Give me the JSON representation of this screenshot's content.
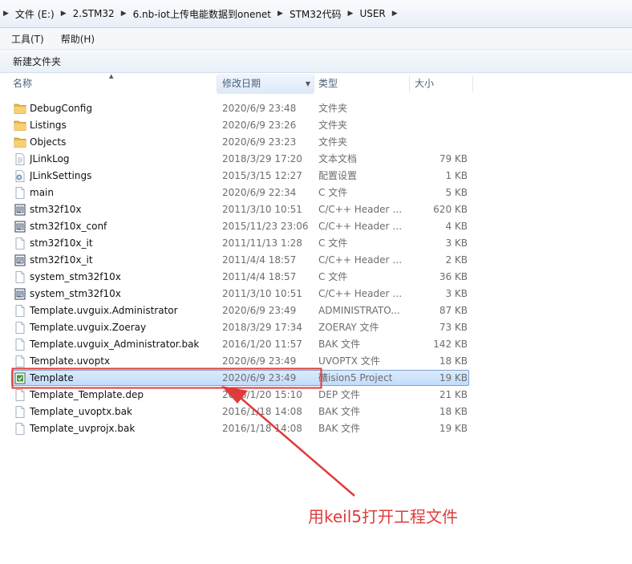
{
  "breadcrumb": {
    "items": [
      "文件 (E:)",
      "2.STM32",
      "6.nb-iot上传电能数据到onenet",
      "STM32代码",
      "USER"
    ]
  },
  "menubar": {
    "tools": "工具(T)",
    "help": "帮助(H)"
  },
  "toolbar": {
    "new_folder": "新建文件夹"
  },
  "columns": {
    "name": "名称",
    "date": "修改日期",
    "type": "类型",
    "size": "大小"
  },
  "files": [
    {
      "name": "DebugConfig",
      "date": "2020/6/9 23:48",
      "type": "文件夹",
      "size": "",
      "icon": "folder-icon"
    },
    {
      "name": "Listings",
      "date": "2020/6/9 23:26",
      "type": "文件夹",
      "size": "",
      "icon": "folder-icon"
    },
    {
      "name": "Objects",
      "date": "2020/6/9 23:23",
      "type": "文件夹",
      "size": "",
      "icon": "folder-icon"
    },
    {
      "name": "JLinkLog",
      "date": "2018/3/29 17:20",
      "type": "文本文档",
      "size": "79 KB",
      "icon": "text-file-icon"
    },
    {
      "name": "JLinkSettings",
      "date": "2015/3/15 12:27",
      "type": "配置设置",
      "size": "1 KB",
      "icon": "settings-file-icon"
    },
    {
      "name": "main",
      "date": "2020/6/9 22:34",
      "type": "C 文件",
      "size": "5 KB",
      "icon": "c-file-icon"
    },
    {
      "name": "stm32f10x",
      "date": "2011/3/10 10:51",
      "type": "C/C++ Header F...",
      "size": "620 KB",
      "icon": "header-file-icon"
    },
    {
      "name": "stm32f10x_conf",
      "date": "2015/11/23 23:06",
      "type": "C/C++ Header F...",
      "size": "4 KB",
      "icon": "header-file-icon"
    },
    {
      "name": "stm32f10x_it",
      "date": "2011/11/13 1:28",
      "type": "C 文件",
      "size": "3 KB",
      "icon": "c-file-icon"
    },
    {
      "name": "stm32f10x_it",
      "date": "2011/4/4 18:57",
      "type": "C/C++ Header F...",
      "size": "2 KB",
      "icon": "header-file-icon"
    },
    {
      "name": "system_stm32f10x",
      "date": "2011/4/4 18:57",
      "type": "C 文件",
      "size": "36 KB",
      "icon": "c-file-icon"
    },
    {
      "name": "system_stm32f10x",
      "date": "2011/3/10 10:51",
      "type": "C/C++ Header F...",
      "size": "3 KB",
      "icon": "header-file-icon"
    },
    {
      "name": "Template.uvguix.Administrator",
      "date": "2020/6/9 23:49",
      "type": "ADMINISTRATO...",
      "size": "87 KB",
      "icon": "generic-file-icon"
    },
    {
      "name": "Template.uvguix.Zoeray",
      "date": "2018/3/29 17:34",
      "type": "ZOERAY 文件",
      "size": "73 KB",
      "icon": "generic-file-icon"
    },
    {
      "name": "Template.uvguix_Administrator.bak",
      "date": "2016/1/20 11:57",
      "type": "BAK 文件",
      "size": "142 KB",
      "icon": "generic-file-icon"
    },
    {
      "name": "Template.uvoptx",
      "date": "2020/6/9 23:49",
      "type": "UVOPTX 文件",
      "size": "18 KB",
      "icon": "generic-file-icon"
    },
    {
      "name": "Template",
      "date": "2020/6/9 23:49",
      "type": "礦ision5 Project",
      "size": "19 KB",
      "icon": "keil-project-icon",
      "selected": true
    },
    {
      "name": "Template_Template.dep",
      "date": "2016/1/20 15:10",
      "type": "DEP 文件",
      "size": "21 KB",
      "icon": "generic-file-icon"
    },
    {
      "name": "Template_uvoptx.bak",
      "date": "2016/1/18 14:08",
      "type": "BAK 文件",
      "size": "18 KB",
      "icon": "generic-file-icon"
    },
    {
      "name": "Template_uvprojx.bak",
      "date": "2016/1/18 14:08",
      "type": "BAK 文件",
      "size": "19 KB",
      "icon": "generic-file-icon"
    }
  ],
  "annotation": {
    "text": "用keil5打开工程文件",
    "color": "#e03b3b"
  }
}
